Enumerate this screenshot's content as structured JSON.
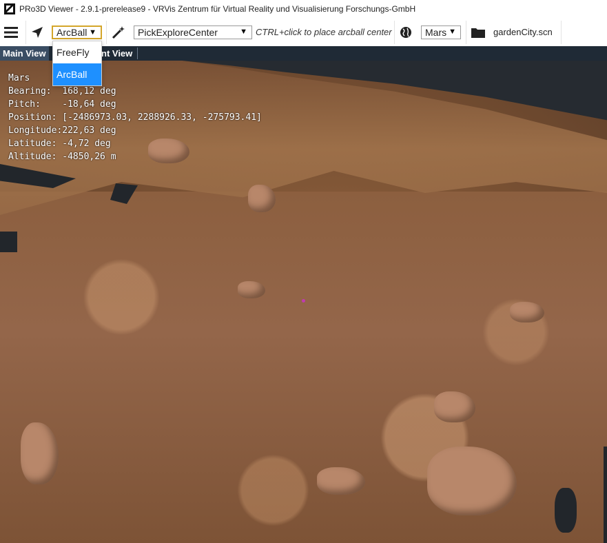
{
  "window": {
    "title": "PRo3D Viewer - 2.9.1-prerelease9 - VRVis Zentrum für Virtual Reality und Visualisierung Forschungs-GmbH"
  },
  "toolbar": {
    "menu_icon": "hamburger-menu-icon",
    "nav_icon": "navigation-arrow-icon",
    "nav_mode": {
      "selected": "ArcBall",
      "options": [
        "FreeFly",
        "ArcBall"
      ]
    },
    "pick_icon": "magic-wand-icon",
    "pick_mode": {
      "selected": "PickExploreCenter"
    },
    "pick_hint": "CTRL+click to place arcball center",
    "planet_icon": "globe-icon",
    "planet": {
      "selected": "Mars"
    },
    "folder_icon": "folder-icon",
    "scene_file": "gardenCity.scn"
  },
  "view_tabs": [
    {
      "label": "Main View",
      "active": true
    },
    {
      "label": "nt View",
      "active": false
    }
  ],
  "hud": {
    "planet": "Mars",
    "bearing": "Bearing:  168,12 deg",
    "pitch": "Pitch:    -18,64 deg",
    "position": "Position: [-2486973.03, 2288926.33, -275793.41]",
    "longitude": "Longitude:222,63 deg",
    "latitude": "Latitude: -4,72 deg",
    "altitude": "Altitude: -4850,26 m"
  },
  "colors": {
    "accent": "#1e90ff",
    "dropdown_active_border": "#d4a62a",
    "tab_bar": "#1f2a36",
    "sky": "#262b31",
    "pick_marker": "#c03ab0"
  }
}
